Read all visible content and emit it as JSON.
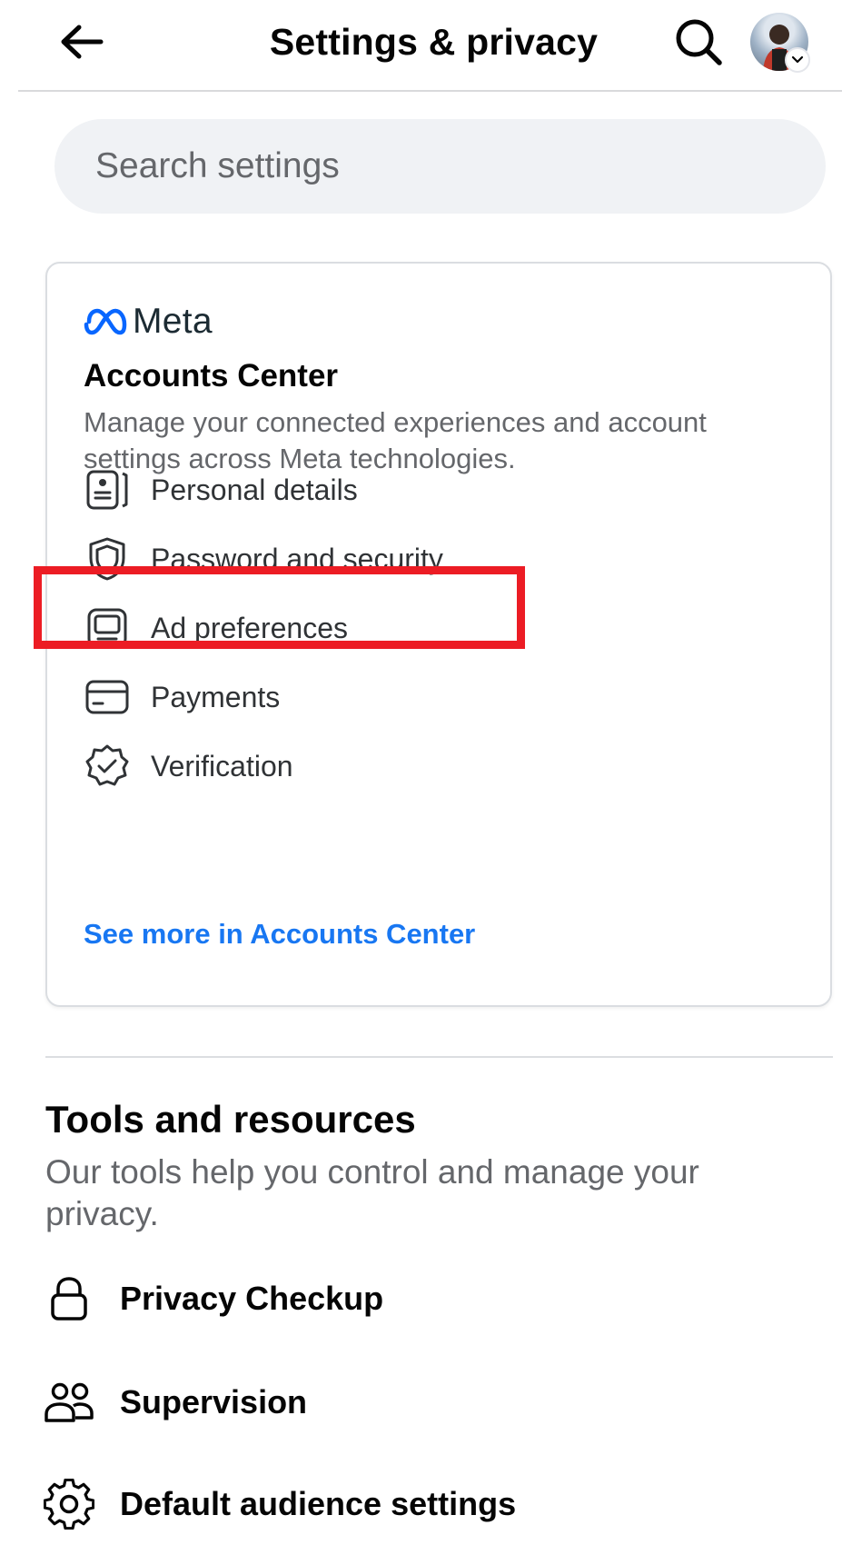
{
  "header": {
    "title": "Settings & privacy",
    "back_icon": "arrow-left-icon",
    "search_icon": "search-icon",
    "avatar_icon": "avatar"
  },
  "search": {
    "placeholder": "Search settings",
    "value": ""
  },
  "accounts_center": {
    "brand": "Meta",
    "title": "Accounts Center",
    "description": "Manage your connected experiences and account settings across Meta technologies.",
    "items": [
      {
        "label": "Personal details",
        "icon": "id-card-icon"
      },
      {
        "label": "Password and security",
        "icon": "shield-icon"
      },
      {
        "label": "Ad preferences",
        "icon": "monitor-icon"
      },
      {
        "label": "Payments",
        "icon": "credit-card-icon"
      },
      {
        "label": "Verification",
        "icon": "verified-badge-icon"
      }
    ],
    "see_more": "See more in Accounts Center",
    "highlighted_item": "Password and security"
  },
  "tools": {
    "title": "Tools and resources",
    "description": "Our tools help you control and manage your privacy.",
    "items": [
      {
        "label": "Privacy Checkup",
        "icon": "lock-icon"
      },
      {
        "label": "Supervision",
        "icon": "people-icon"
      },
      {
        "label": "Default audience settings",
        "icon": "gear-icon"
      }
    ]
  },
  "colors": {
    "link": "#1877f2",
    "highlight": "#ec1c24",
    "search_bg": "#f0f2f5",
    "secondary_text": "#65676b"
  }
}
